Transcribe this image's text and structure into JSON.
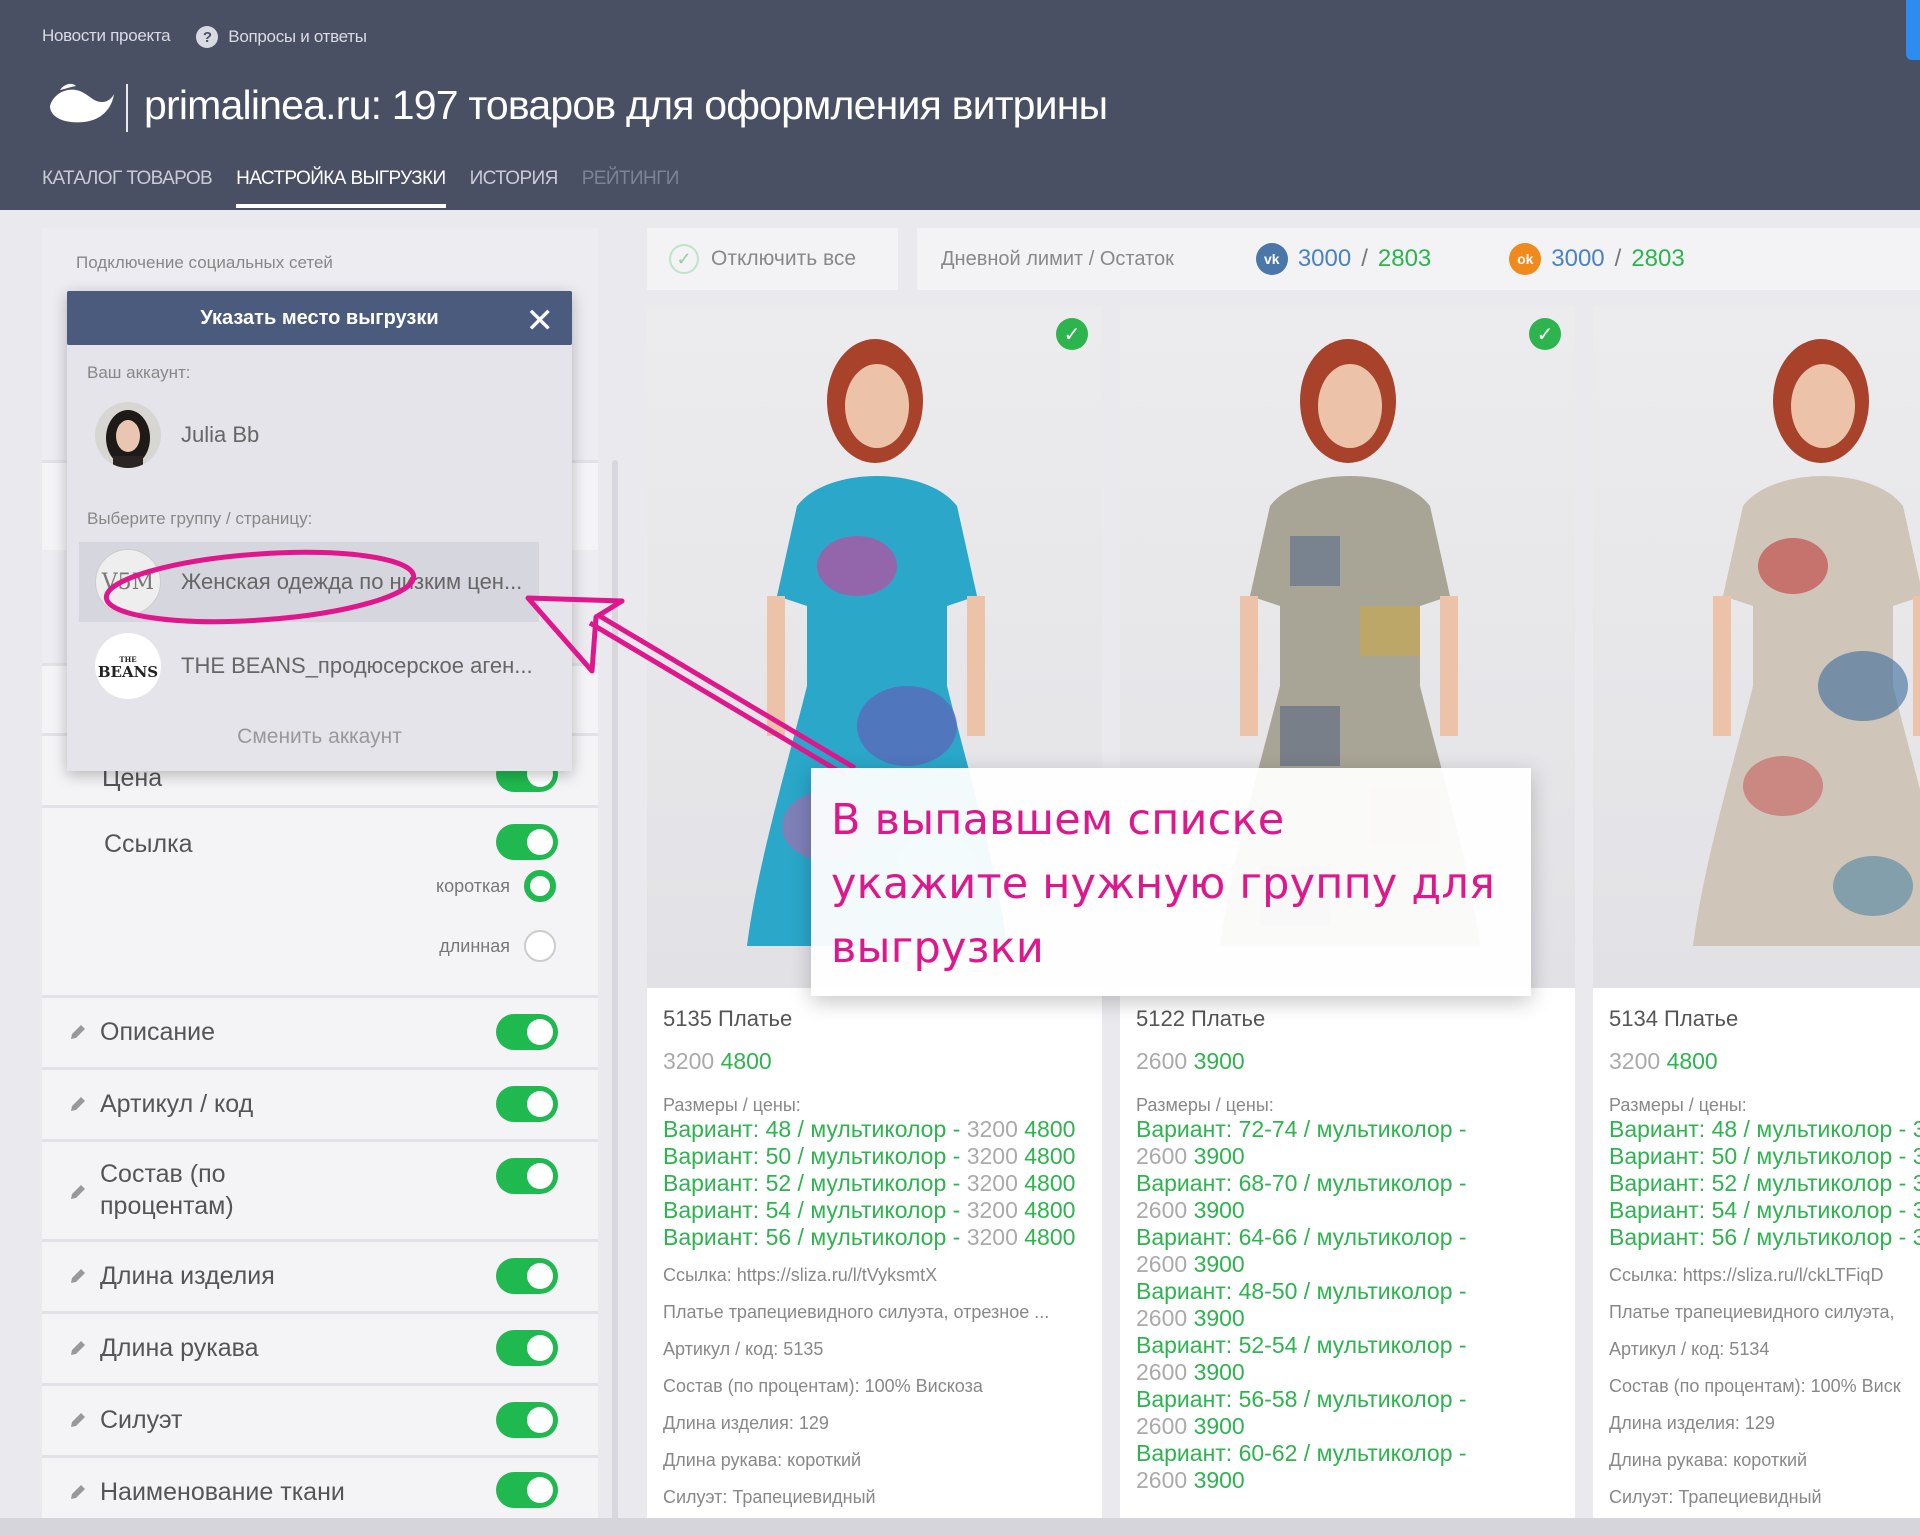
{
  "header": {
    "top_links": {
      "news": "Новости проекта",
      "faq": "Вопросы и ответы"
    },
    "title": "primalinea.ru:  197 товаров для оформления витрины",
    "tabs": [
      "КАТАЛОГ ТОВАРОВ",
      "НАСТРОЙКА ВЫГРУЗКИ",
      "ИСТОРИЯ",
      "РЕЙТИНГИ"
    ]
  },
  "left": {
    "social_label": "Подключение социальных сетей",
    "rows": {
      "price": "Цена",
      "link": "Ссылка",
      "link_short": "короткая",
      "link_long": "длинная",
      "description": "Описание",
      "article": "Артикул / код",
      "composition": "Состав (по процентам)",
      "length": "Длина изделия",
      "sleeve": "Длина рукава",
      "silhouette": "Силуэт",
      "fabric": "Наименование ткани"
    }
  },
  "dropdown": {
    "header": "Указать место выгрузки",
    "close": "✕",
    "account_caption": "Ваш аккаунт:",
    "account_name": "Julia Bb",
    "group_caption": "Выберите группу / страницу:",
    "groups": [
      {
        "label": "Женская одежда по низким цен...",
        "avatar_text": "V5M"
      },
      {
        "label": "THE BEANS_продюсерское аген...",
        "avatar_text": "BEANS",
        "avatar_small": "THE"
      }
    ],
    "switch_account": "Сменить аккаунт"
  },
  "toolbar": {
    "disable_all": "Отключить все",
    "daily_limit": "Дневной лимит / Остаток",
    "vk": {
      "icon": "vk-icon",
      "total": "3000",
      "sep": "/",
      "remaining": "2803"
    },
    "ok": {
      "icon": "ok-icon",
      "total": "3000",
      "sep": "/",
      "remaining": "2803"
    }
  },
  "colors": {
    "accent_green": "#2db44f",
    "header_bg": "#4a5064",
    "annotation": "#e0168c"
  },
  "cards": [
    {
      "name": "5135 Платье",
      "old_price": "3200",
      "new_price": "4800",
      "sizes_caption": "Размеры / цены:",
      "variants": [
        {
          "text": "Вариант: 48 / мультиколор -",
          "old": "3200",
          "new": "4800"
        },
        {
          "text": "Вариант: 50 / мультиколор -",
          "old": "3200",
          "new": "4800"
        },
        {
          "text": "Вариант: 52 / мультиколор -",
          "old": "3200",
          "new": "4800"
        },
        {
          "text": "Вариант: 54 / мультиколор -",
          "old": "3200",
          "new": "4800"
        },
        {
          "text": "Вариант: 56 / мультиколор -",
          "old": "3200",
          "new": "4800"
        }
      ],
      "meta": [
        "Ссылка: https://sliza.ru/l/tVyksmtX",
        "Платье трапециевидного силуэта, отрезное ...",
        "Артикул / код: 5135",
        "Состав (по процентам): 100% Вискоза",
        "Длина изделия: 129",
        "Длина рукава: короткий",
        "Силуэт: Трапециевидный"
      ]
    },
    {
      "name": "5122 Платье",
      "old_price": "2600",
      "new_price": "3900",
      "sizes_caption": "Размеры / цены:",
      "variants": [
        {
          "text": "Вариант: 72-74 / мультиколор -",
          "old": "2600",
          "new": "3900"
        },
        {
          "text": "Вариант: 68-70 / мультиколор -",
          "old": "2600",
          "new": "3900"
        },
        {
          "text": "Вариант: 64-66 / мультиколор -",
          "old": "2600",
          "new": "3900"
        },
        {
          "text": "Вариант: 48-50 / мультиколор -",
          "old": "2600",
          "new": "3900"
        },
        {
          "text": "Вариант: 52-54 / мультиколор -",
          "old": "2600",
          "new": "3900"
        },
        {
          "text": "Вариант: 56-58 / мультиколор -",
          "old": "2600",
          "new": "3900"
        },
        {
          "text": "Вариант: 60-62 / мультиколор -",
          "old": "2600",
          "new": "3900"
        }
      ],
      "meta": []
    },
    {
      "name": "5134 Платье",
      "old_price": "3200",
      "new_price": "4800",
      "sizes_caption": "Размеры / цены:",
      "variants": [
        {
          "text": "Вариант: 48 / мультиколор - 3",
          "old": "",
          "new": ""
        },
        {
          "text": "Вариант: 50 / мультиколор - 3",
          "old": "",
          "new": ""
        },
        {
          "text": "Вариант: 52 / мультиколор - 3",
          "old": "",
          "new": ""
        },
        {
          "text": "Вариант: 54 / мультиколор - 3",
          "old": "",
          "new": ""
        },
        {
          "text": "Вариант: 56 / мультиколор - 3",
          "old": "",
          "new": ""
        }
      ],
      "meta": [
        "Ссылка: https://sliza.ru/l/ckLTFiqD",
        "Платье трапециевидного силуэта,",
        "Артикул / код: 5134",
        "Состав (по процентам): 100% Виск",
        "Длина изделия: 129",
        "Длина рукава: короткий",
        "Силуэт: Трапециевидный"
      ]
    }
  ],
  "annotation": {
    "lines": [
      "В выпавшем списке",
      "укажите нужную группу для",
      "выгрузки"
    ]
  }
}
